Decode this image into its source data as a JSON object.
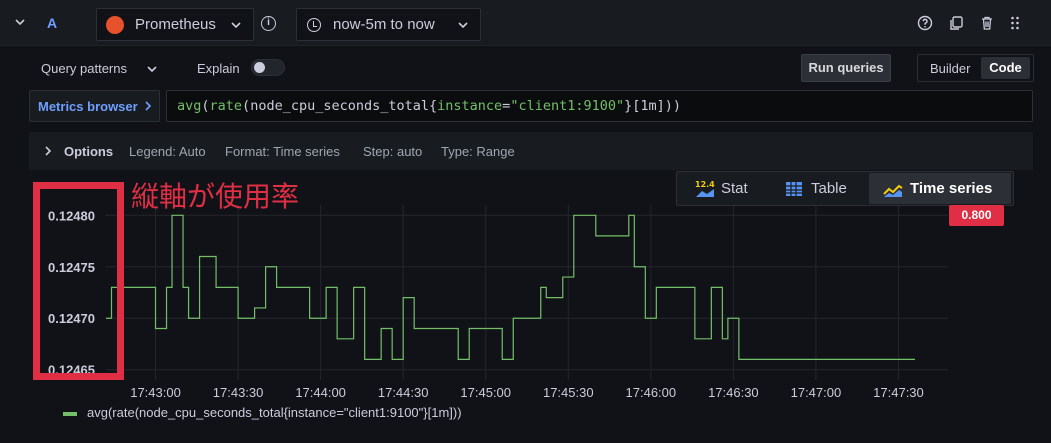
{
  "header": {
    "query_letter": "A",
    "datasource": "Prometheus",
    "time_range": "now-5m to now",
    "colors": {
      "accent": "#6e9fff",
      "datasource_logo": "#e6522c"
    }
  },
  "editor": {
    "query_patterns_label": "Query patterns",
    "explain_label": "Explain",
    "explain_on": false,
    "run_queries_label": "Run queries",
    "mode_builder": "Builder",
    "mode_code": "Code",
    "active_mode": "Code",
    "metrics_browser_label": "Metrics browser",
    "query": {
      "fn_avg": "avg",
      "fn_rate": "rate",
      "metric": "node_cpu_seconds_total",
      "label_key": "instance",
      "label_value": "\"client1:9100\"",
      "range": "[1m]"
    }
  },
  "options": {
    "label": "Options",
    "legend": "Legend: Auto",
    "format": "Format: Time series",
    "step": "Step: auto",
    "type": "Type: Range"
  },
  "visualization_switch": {
    "items": [
      {
        "label": "Stat",
        "icon": "stat-icon",
        "badge": "12.4"
      },
      {
        "label": "Table",
        "icon": "table-icon"
      },
      {
        "label": "Time series",
        "icon": "time-series-icon",
        "active": true
      }
    ]
  },
  "annotation": {
    "text": "縦軸が使用率",
    "color": "#e02f44"
  },
  "tooltip_value": "0.800",
  "chart_data": {
    "type": "line",
    "x_ticks": [
      "17:43:00",
      "17:43:30",
      "17:44:00",
      "17:44:30",
      "17:45:00",
      "17:45:30",
      "17:46:00",
      "17:46:30",
      "17:47:00",
      "17:47:30"
    ],
    "y_ticks": [
      "0.12480",
      "0.12475",
      "0.12470",
      "0.12465"
    ],
    "ylim": [
      0.12464,
      0.12481
    ],
    "grid": true,
    "legend_position": "bottom-left",
    "series": [
      {
        "name": "avg(rate(node_cpu_seconds_total{instance=\"client1:9100\"}[1m]))",
        "color": "#73bf69",
        "x_seconds": [
          0,
          2,
          4,
          6,
          8,
          10,
          12,
          14,
          16,
          18,
          20,
          22,
          24,
          26,
          28,
          30,
          32,
          34,
          36,
          38,
          40,
          42,
          44,
          46,
          48,
          50,
          52,
          54,
          56,
          58,
          60,
          62,
          64,
          66,
          68,
          70,
          72,
          74,
          76,
          78,
          80,
          82,
          84,
          86,
          88,
          90,
          92,
          94,
          96,
          98,
          100,
          102,
          104,
          106,
          108,
          110,
          112,
          114,
          116,
          118,
          120,
          122,
          124,
          126,
          128,
          130,
          132,
          134,
          136,
          138,
          140,
          142,
          144,
          146,
          148,
          150,
          152,
          154,
          156,
          158,
          160,
          162,
          164,
          166,
          168,
          170,
          172,
          174,
          176,
          178,
          180,
          182,
          184,
          186,
          188,
          190,
          192,
          194,
          196,
          198,
          200,
          202,
          204,
          206,
          208,
          210,
          212,
          214,
          216,
          218,
          220,
          222,
          224,
          226,
          228,
          230,
          232,
          234,
          236,
          238,
          240,
          242,
          244,
          246,
          248,
          250,
          252,
          254,
          256,
          258,
          260,
          262,
          264,
          266,
          268,
          270,
          272,
          274,
          276,
          278,
          280,
          282,
          284,
          286,
          288
        ],
        "values": [
          0.1247,
          0.12473,
          0.12473,
          0.12473,
          0.12473,
          0.12473,
          0.12473,
          0.12473,
          0.12473,
          0.12469,
          0.12469,
          0.12473,
          0.1248,
          0.1248,
          0.12473,
          0.1247,
          0.1247,
          0.12476,
          0.12476,
          0.12476,
          0.12473,
          0.12473,
          0.12473,
          0.12473,
          0.1247,
          0.1247,
          0.1247,
          0.12471,
          0.12471,
          0.12475,
          0.12475,
          0.12473,
          0.12473,
          0.12473,
          0.12473,
          0.12473,
          0.12473,
          0.1247,
          0.1247,
          0.1247,
          0.12473,
          0.12473,
          0.12468,
          0.12468,
          0.12468,
          0.12473,
          0.12473,
          0.12466,
          0.12466,
          0.12466,
          0.12469,
          0.12469,
          0.12466,
          0.12466,
          0.12472,
          0.12472,
          0.12469,
          0.12469,
          0.12469,
          0.12469,
          0.12469,
          0.12469,
          0.12469,
          0.12469,
          0.12466,
          0.12466,
          0.12469,
          0.12469,
          0.12469,
          0.12469,
          0.12469,
          0.12469,
          0.12466,
          0.12466,
          0.1247,
          0.1247,
          0.1247,
          0.1247,
          0.1247,
          0.12473,
          0.12472,
          0.12472,
          0.12472,
          0.12474,
          0.12474,
          0.1248,
          0.1248,
          0.1248,
          0.1248,
          0.12478,
          0.12478,
          0.12478,
          0.12478,
          0.12478,
          0.12478,
          0.1248,
          0.12475,
          0.12475,
          0.1247,
          0.1247,
          0.12473,
          0.12473,
          0.12473,
          0.12473,
          0.12473,
          0.12473,
          0.12473,
          0.12468,
          0.12468,
          0.12468,
          0.12473,
          0.12473,
          0.12468,
          0.1247,
          0.1247,
          0.12466,
          0.12466
        ]
      }
    ]
  }
}
